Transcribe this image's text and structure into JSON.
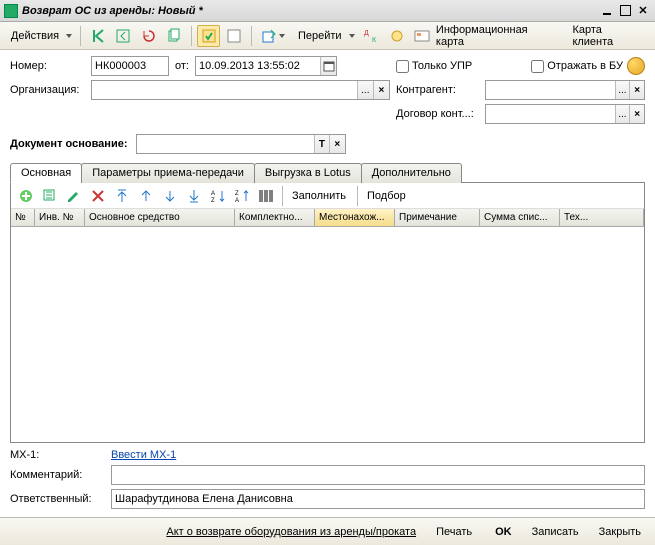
{
  "window": {
    "title": "Возврат ОС из аренды: Новый *"
  },
  "toolbar": {
    "actions": "Действия",
    "go": "Перейти",
    "infocard": "Информационная карта",
    "clientcard": "Карта клиента"
  },
  "header": {
    "number_label": "Номер:",
    "number_value": "НК000003",
    "from_label": "от:",
    "date_value": "10.09.2013 13:55:02",
    "only_upr": "Только УПР",
    "reflect_bu": "Отражать в БУ",
    "org_label": "Организация:",
    "counterparty_label": "Контрагент:",
    "contract_label": "Договор конт...:"
  },
  "docbase": {
    "label": "Документ основание:"
  },
  "tabs": {
    "t1": "Основная",
    "t2": "Параметры приема-передачи",
    "t3": "Выгрузка в Lotus",
    "t4": "Дополнительно"
  },
  "subtoolbar": {
    "fill": "Заполнить",
    "select": "Подбор"
  },
  "grid": {
    "cols": [
      "№",
      "Инв. №",
      "Основное средство",
      "Комплектно...",
      "Местонахож...",
      "Примечание",
      "Сумма спис...",
      "Тех..."
    ]
  },
  "footer": {
    "mx1_label": "МХ-1:",
    "mx1_link": "Ввести МХ-1",
    "comment_label": "Комментарий:",
    "resp_label": "Ответственный:",
    "resp_value": "Шарафутдинова Елена Данисовна"
  },
  "bottom": {
    "act": "Акт о возврате оборудования из аренды/проката",
    "print": "Печать",
    "ok": "OK",
    "write": "Записать",
    "close": "Закрыть"
  }
}
